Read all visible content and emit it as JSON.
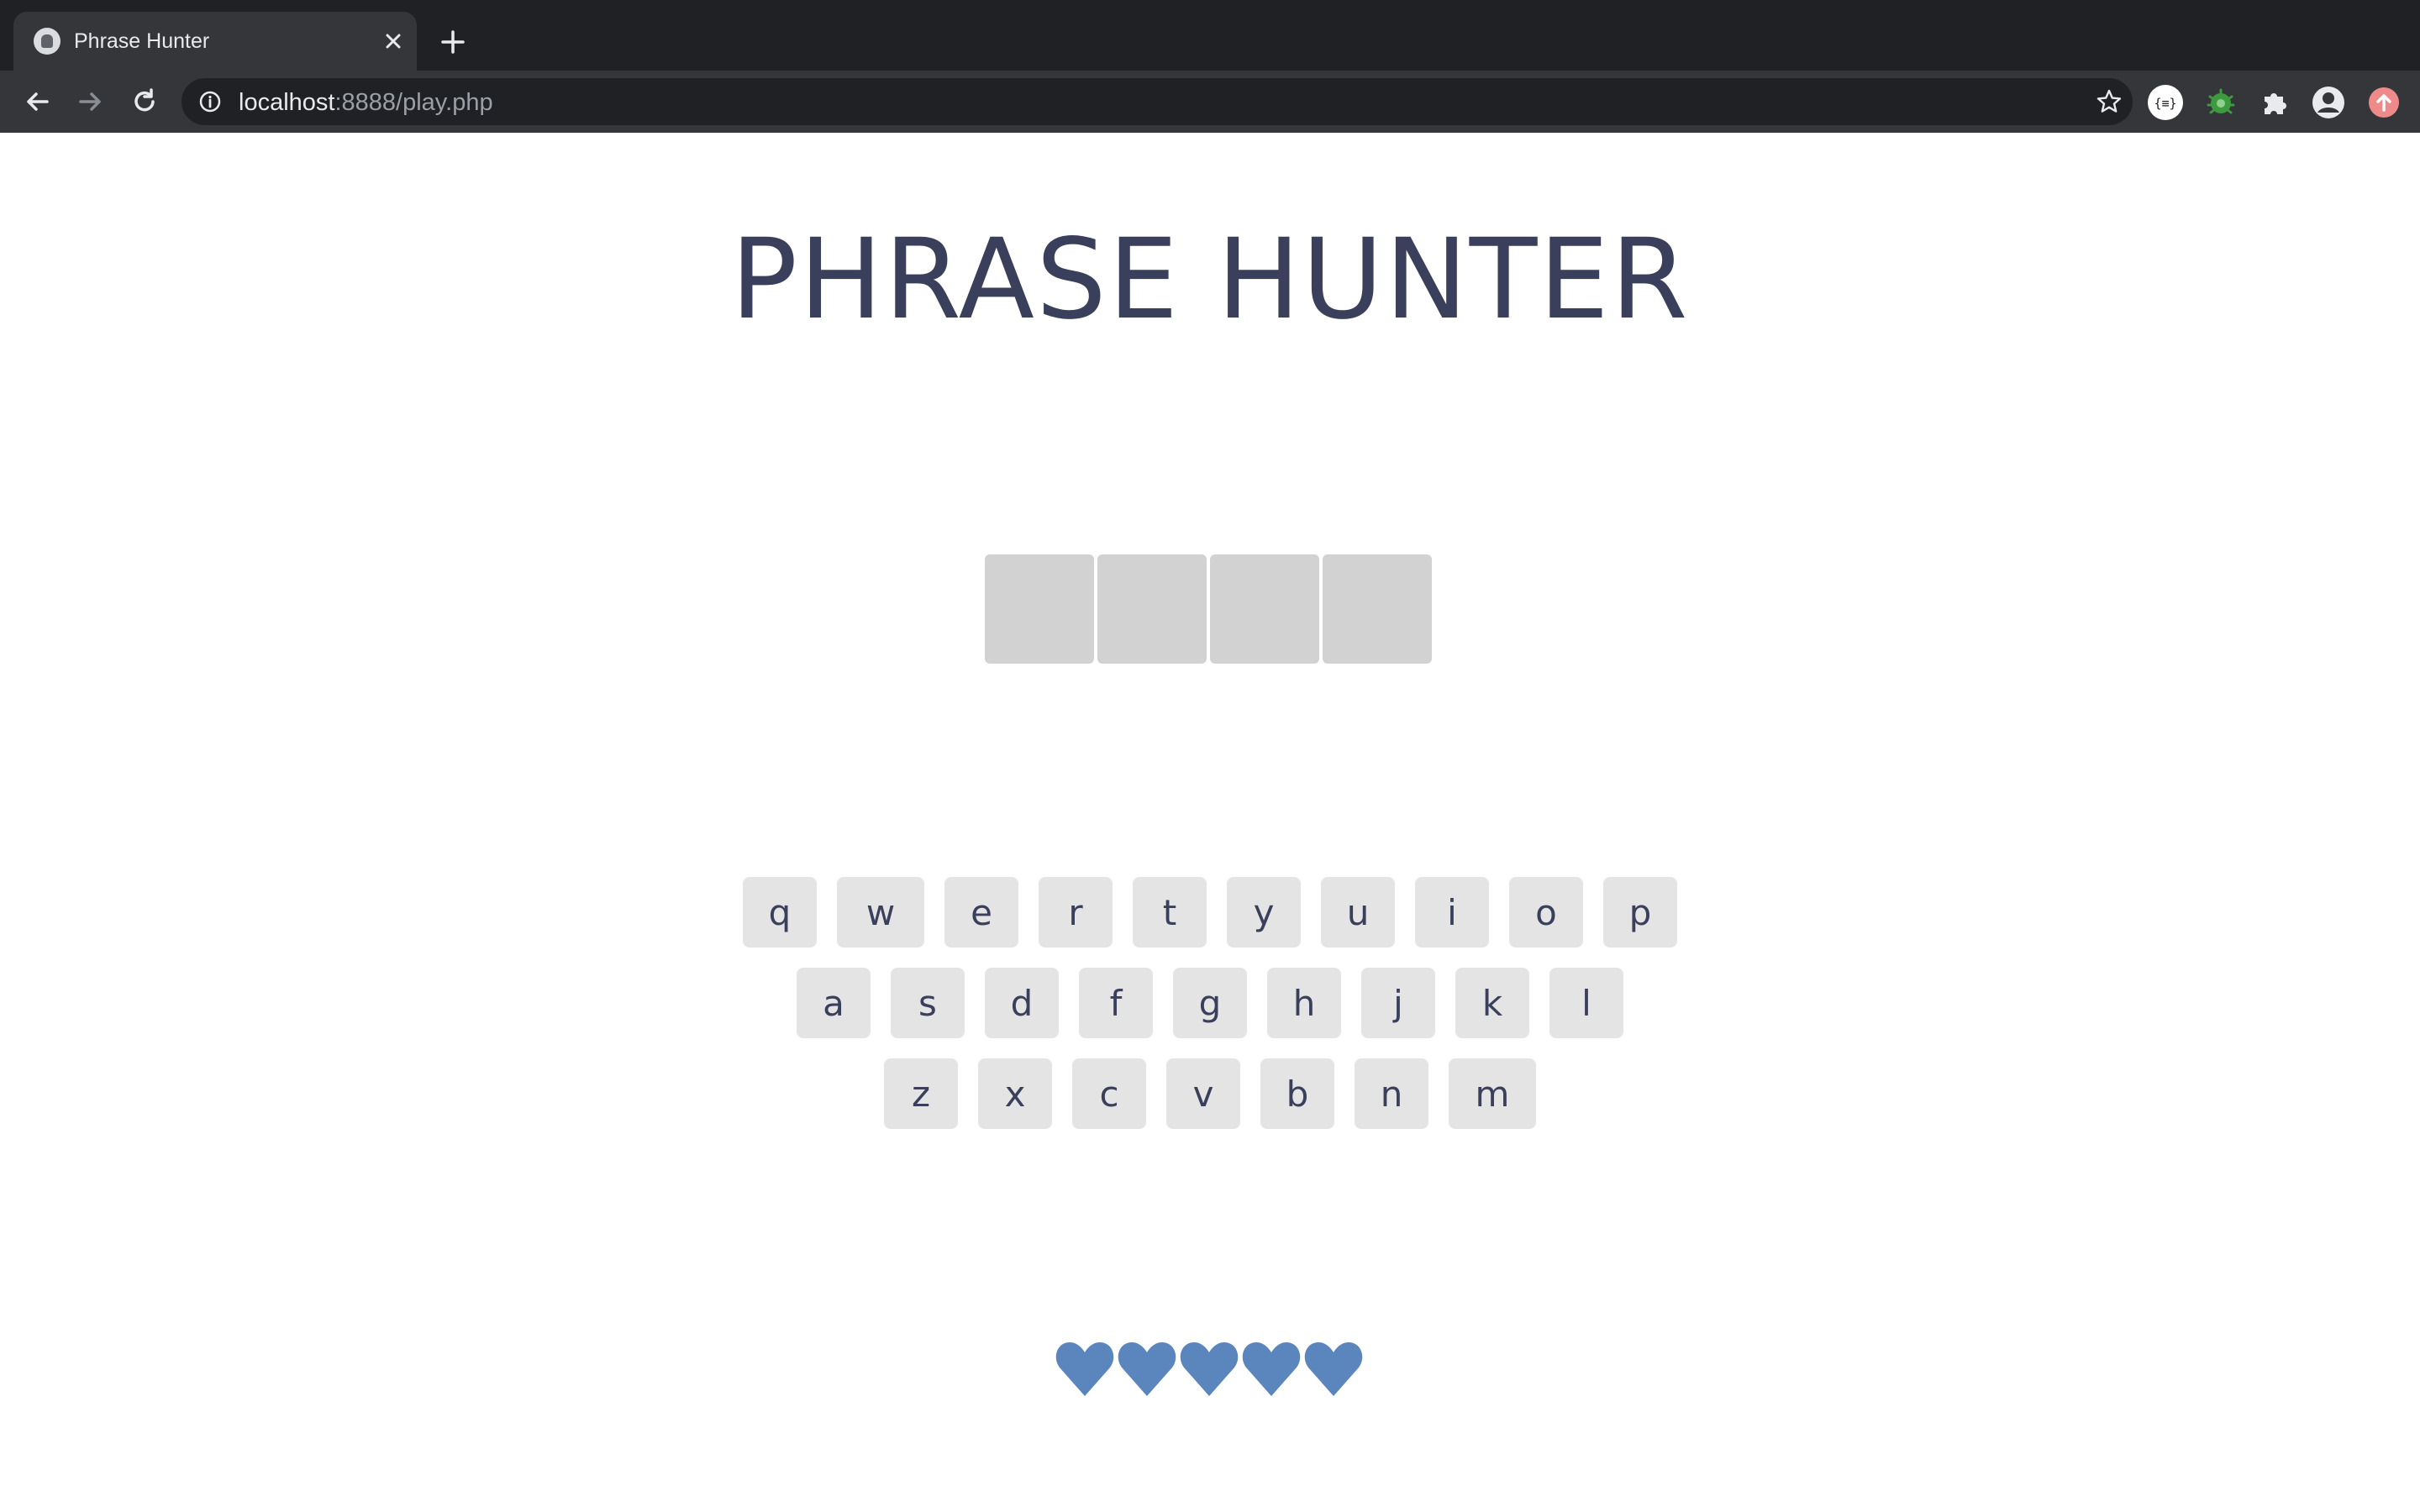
{
  "browser": {
    "tab_title": "Phrase Hunter",
    "url_host": "localhost",
    "url_rest": ":8888/play.php",
    "extensions": [
      "json-viewer-icon",
      "bug-extension-icon",
      "puzzle-piece-icon",
      "profile-avatar-icon",
      "update-icon"
    ]
  },
  "game": {
    "title": "PHRASE HUNTER",
    "phrase_letter_count": 4,
    "keyboard": {
      "row1": [
        "q",
        "w",
        "e",
        "r",
        "t",
        "y",
        "u",
        "i",
        "o",
        "p"
      ],
      "row2": [
        "a",
        "s",
        "d",
        "f",
        "g",
        "h",
        "j",
        "k",
        "l"
      ],
      "row3": [
        "z",
        "x",
        "c",
        "v",
        "b",
        "n",
        "m"
      ]
    },
    "lives": 5,
    "heart_color": "#5b85bd",
    "key_color": "#e4e4e4",
    "hidden_letter_color": "#d2d2d2",
    "title_color": "#3a3f5c"
  }
}
